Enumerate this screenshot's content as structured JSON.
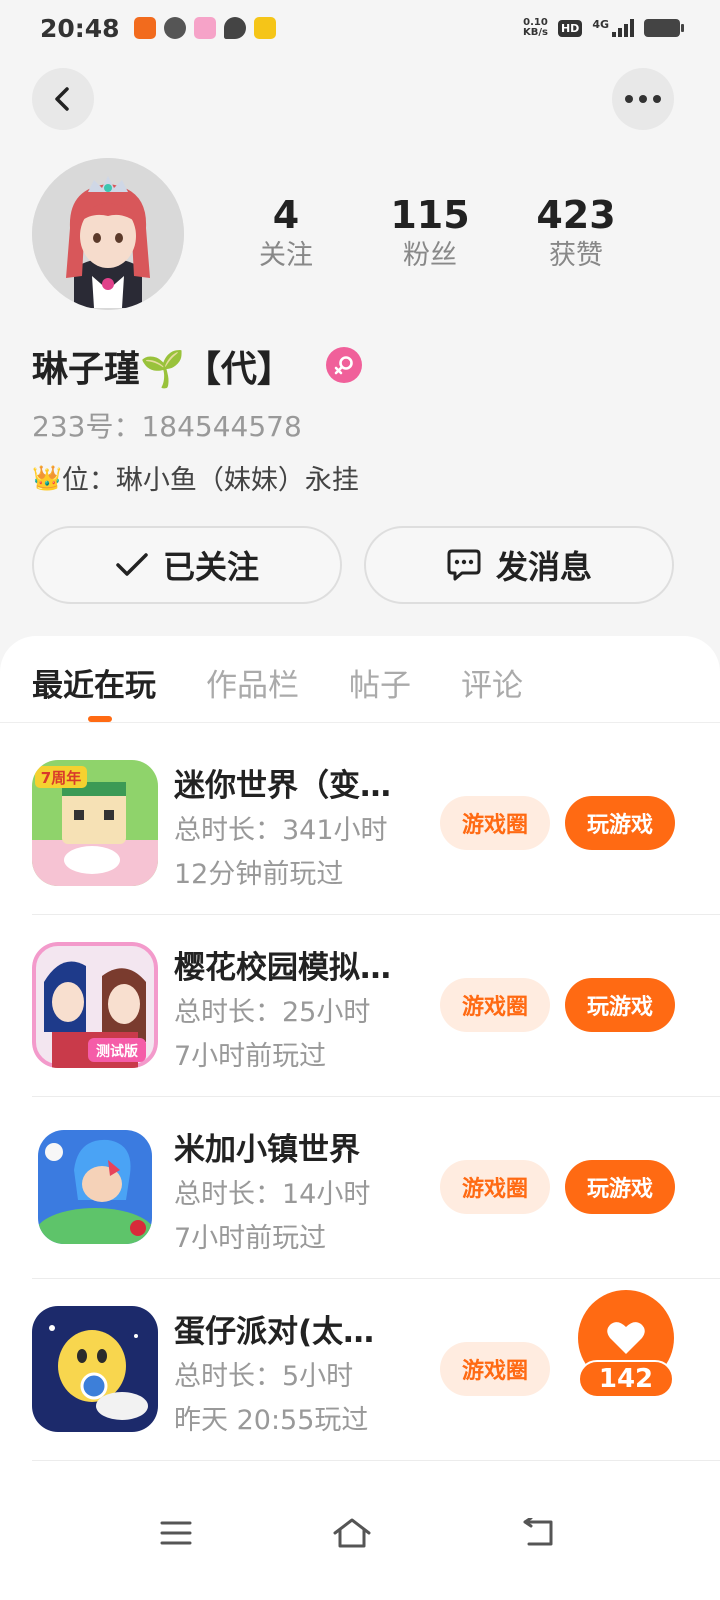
{
  "status_bar": {
    "time": "20:48",
    "net_speed_value": "0.10",
    "net_speed_unit": "KB/s",
    "hd_label": "HD",
    "network_label": "4G"
  },
  "header": {
    "back_icon": "chevron-left-icon",
    "more_icon": "more-dots-icon"
  },
  "profile": {
    "stats": [
      {
        "value": "4",
        "label": "关注"
      },
      {
        "value": "115",
        "label": "粉丝"
      },
      {
        "value": "423",
        "label": "获赞"
      }
    ],
    "username": "琳子瑾🌱【代】",
    "gender_icon": "female-icon",
    "user_id": "233号：184544578",
    "bio_crown": "👑",
    "bio": "位：琳小鱼（妹妹）永挂",
    "follow_button": "已关注",
    "message_button": "发消息"
  },
  "tabs": [
    {
      "label": "最近在玩",
      "active": true
    },
    {
      "label": "作品栏",
      "active": false
    },
    {
      "label": "帖子",
      "active": false
    },
    {
      "label": "评论",
      "active": false
    }
  ],
  "games": [
    {
      "title": "迷你世界（变…",
      "duration": "总时长：341小时",
      "last_played": "12分钟前玩过",
      "circle_label": "游戏圈",
      "play_label": "玩游戏",
      "badge": "7周年"
    },
    {
      "title": "樱花校园模拟…",
      "duration": "总时长：25小时",
      "last_played": "7小时前玩过",
      "circle_label": "游戏圈",
      "play_label": "玩游戏",
      "badge": "测试版"
    },
    {
      "title": "米加小镇世界",
      "duration": "总时长：14小时",
      "last_played": "7小时前玩过",
      "circle_label": "游戏圈",
      "play_label": "玩游戏",
      "badge": ""
    },
    {
      "title": "蛋仔派对(太…",
      "duration": "总时长：5小时",
      "last_played": "昨天 20:55玩过",
      "circle_label": "游戏圈",
      "play_label": "",
      "badge": ""
    }
  ],
  "like_fab": {
    "count": "142",
    "icon": "heart-icon"
  },
  "colors": {
    "accent": "#ff6a13",
    "accent_light": "#ffece0",
    "female": "#f0609a"
  }
}
